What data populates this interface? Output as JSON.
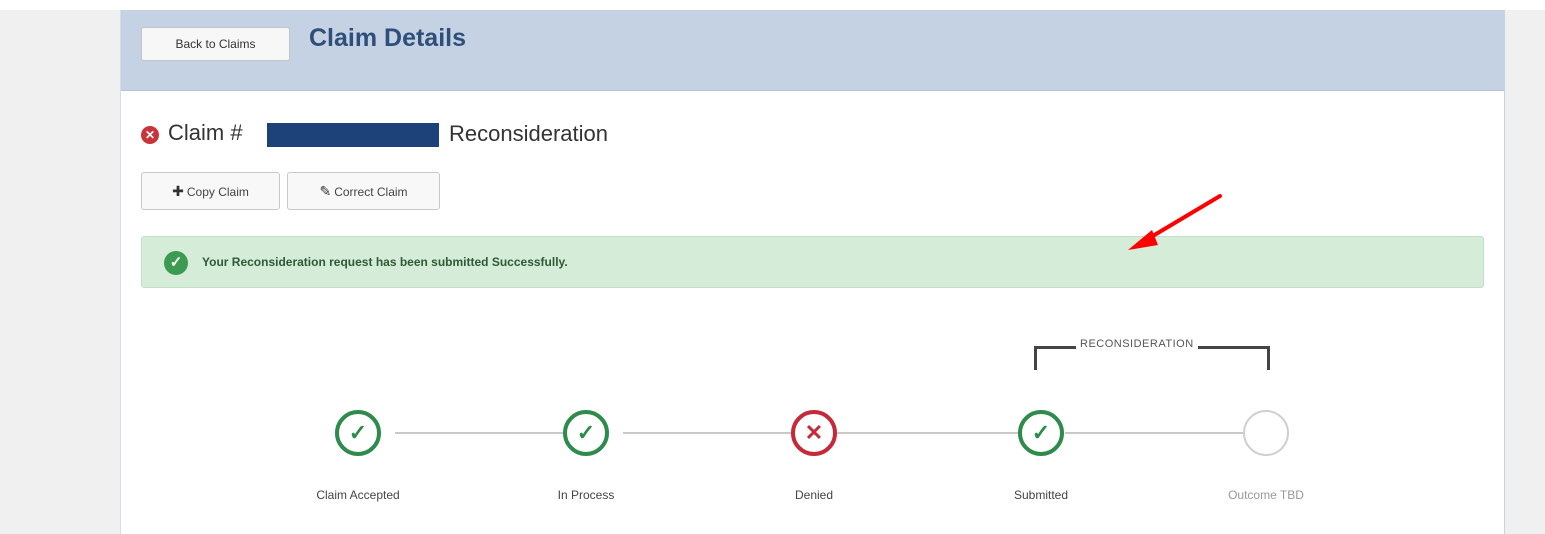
{
  "header": {
    "back_label": "Back to Claims",
    "title": "Claim Details"
  },
  "claim": {
    "prefix": "Claim #",
    "type": "Reconsideration"
  },
  "actions": {
    "copy_label": "Copy Claim",
    "correct_label": "Correct Claim"
  },
  "alert": {
    "message": "Your Reconsideration request has been submitted Successfully."
  },
  "timeline": {
    "group_label": "RECONSIDERATION",
    "steps": [
      {
        "label": "Claim Accepted",
        "status": "complete"
      },
      {
        "label": "In Process",
        "status": "complete"
      },
      {
        "label": "Denied",
        "status": "denied"
      },
      {
        "label": "Submitted",
        "status": "complete"
      },
      {
        "label": "Outcome TBD",
        "status": "pending"
      }
    ]
  },
  "colors": {
    "header_bg": "#c4d2e4",
    "title": "#2f4f7a",
    "success": "#2e8b4d",
    "error": "#c42a3a",
    "alert_bg": "#d4ecd8",
    "redaction": "#1d4279",
    "annotation_arrow": "#ff0000"
  }
}
